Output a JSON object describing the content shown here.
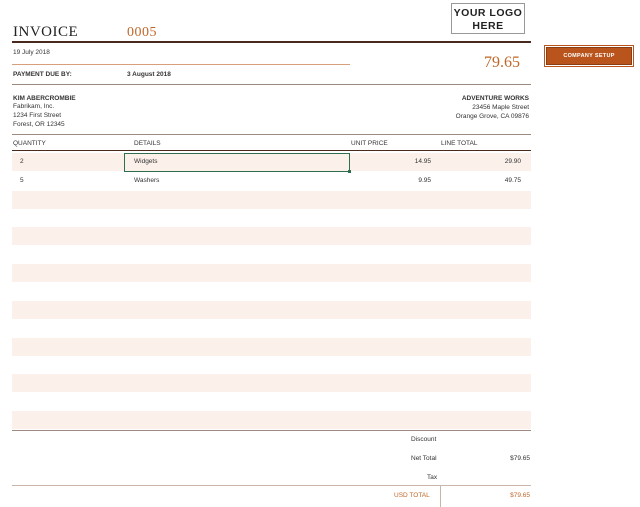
{
  "invoice": {
    "title": "INVOICE",
    "number": "0005",
    "date": "19 July 2018",
    "payment_due_label": "PAYMENT DUE BY:",
    "payment_due_date": "3 August 2018",
    "amount_due": "79.65"
  },
  "logo": {
    "line1": "YOUR LOGO",
    "line2": "HERE"
  },
  "company_setup_label": "COMPANY SETUP",
  "bill_to": {
    "name": "KIM ABERCROMBIE",
    "company": "Fabrikam, Inc.",
    "street": "1234 First Street",
    "city": "Forest, OR 12345"
  },
  "from": {
    "name": "ADVENTURE WORKS",
    "street": "23456 Maple Street",
    "city": "Orange Grove, CA 09876"
  },
  "columns": {
    "quantity": "QUANTITY",
    "details": "DETAILS",
    "unit_price": "UNIT PRICE",
    "line_total": "LINE TOTAL"
  },
  "items": [
    {
      "quantity": "2",
      "details": "Widgets",
      "unit_price": "14.95",
      "line_total": "29.90"
    },
    {
      "quantity": "5",
      "details": "Washers",
      "unit_price": "9.95",
      "line_total": "49.75"
    }
  ],
  "summary": {
    "discount_label": "Discount",
    "net_total_label": "Net Total",
    "net_total_value": "$79.65",
    "tax_label": "Tax",
    "usd_total_label": "USD TOTAL",
    "usd_total_value": "$79.65"
  },
  "colors": {
    "accent": "#c0672a",
    "button": "#b8541c",
    "row_shade": "#fbf1ea",
    "rule": "#4a2a1c",
    "selection": "#2f6e4e"
  }
}
